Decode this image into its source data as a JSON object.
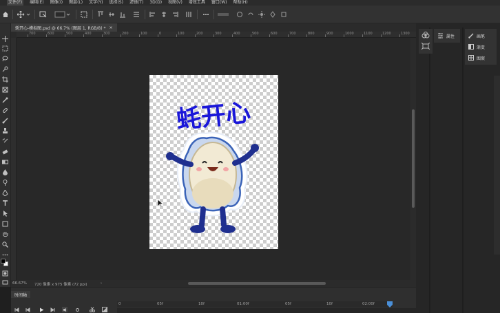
{
  "menu": {
    "items": [
      "文件(F)",
      "编辑(E)",
      "图像(I)",
      "图层(L)",
      "文字(Y)",
      "选择(S)",
      "滤镜(T)",
      "3D(D)",
      "视图(V)",
      "增效工具",
      "窗口(W)",
      "帮助(H)"
    ],
    "active_index": 0
  },
  "document_tab": {
    "title": "蚝开心-模拟图.psd @ 66.7% (图层 1, RGB/8) *",
    "close_glyph": "×"
  },
  "canvas": {
    "artwork_text": "蚝开心",
    "checker_colors": [
      "#ffffff",
      "#cdcdcd"
    ],
    "text_color": "#1a17d9"
  },
  "ruler_h_labels": [
    "700",
    "600",
    "500",
    "400",
    "300",
    "200",
    "100",
    "0",
    "100",
    "200",
    "300",
    "400",
    "500",
    "600",
    "700",
    "800",
    "900",
    "1000",
    "1100",
    "1200",
    "1300",
    "1400"
  ],
  "status": {
    "zoom": "66.67%",
    "doc_size": "720 像素 x 975 像素 (72 ppi)",
    "arrow": "›"
  },
  "timeline": {
    "tab_label": "时间轴",
    "ruler_labels": [
      "0",
      "05f",
      "10f",
      "01:00f",
      "05f",
      "10f",
      "02:00f"
    ]
  },
  "panels": {
    "properties_label": "属性",
    "list": [
      {
        "icon": "brush-icon",
        "label": "画笔"
      },
      {
        "icon": "swatches-icon",
        "label": "渐变"
      },
      {
        "icon": "layers-icon",
        "label": "图案"
      }
    ]
  },
  "colors": {
    "canvas_bg": "#282828",
    "panel_bg": "#323232",
    "accent_blue": "#4a8fd8"
  }
}
